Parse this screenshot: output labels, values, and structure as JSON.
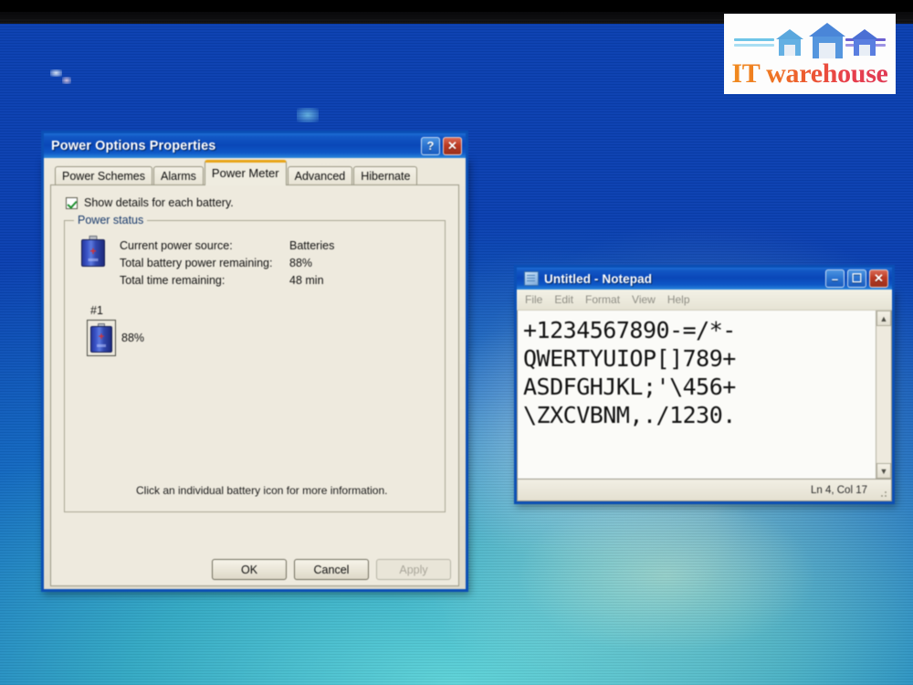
{
  "desktop": {
    "background_top_color": "#0b36ad",
    "background_bottom_color": "#5ccfd4"
  },
  "logo": {
    "text": "IT warehouse",
    "accent_start": "#f08a1e",
    "accent_end": "#e03a55",
    "house_color": "#4a86d8"
  },
  "power_dialog": {
    "title": "Power Options Properties",
    "help_button": "?",
    "close_button": "✕",
    "tabs": [
      {
        "label": "Power Schemes",
        "active": false
      },
      {
        "label": "Alarms",
        "active": false
      },
      {
        "label": "Power Meter",
        "active": true
      },
      {
        "label": "Advanced",
        "active": false
      },
      {
        "label": "Hibernate",
        "active": false
      }
    ],
    "active_tab_accent": "#e8a417",
    "checkbox": {
      "label": "Show details for each battery.",
      "checked": true
    },
    "group_title": "Power status",
    "status": [
      {
        "key": "Current power source:",
        "value": "Batteries"
      },
      {
        "key": "Total battery power remaining:",
        "value": "88%"
      },
      {
        "key": "Total time remaining:",
        "value": "48 min"
      }
    ],
    "battery_label": "#1",
    "battery_percent": "88%",
    "hint": "Click an individual battery icon for more information.",
    "buttons": [
      {
        "label": "OK",
        "disabled": false
      },
      {
        "label": "Cancel",
        "disabled": false
      },
      {
        "label": "Apply",
        "disabled": true
      }
    ]
  },
  "notepad": {
    "title": "Untitled - Notepad",
    "minimize_button": "–",
    "maximize_button": "☐",
    "close_button": "✕",
    "menu": [
      "File",
      "Edit",
      "Format",
      "View",
      "Help"
    ],
    "content": "+1234567890-=/*-\nQWERTYUIOP[]789+\nASDFGHJKL;'\\456+\n\\ZXCVBNM,./1230.",
    "scroll_up": "▲",
    "scroll_down": "▼",
    "status": "Ln 4, Col 17"
  }
}
